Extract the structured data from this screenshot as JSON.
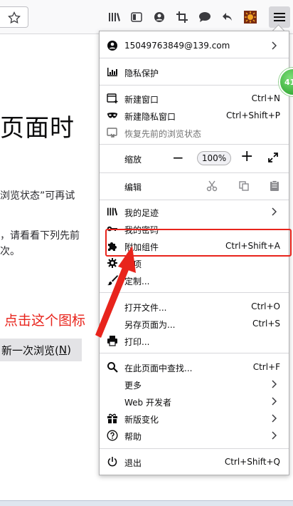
{
  "page": {
    "title_fragment": "页面时",
    "line1_fragment": "浏览状态”可再试",
    "line2_fragment": "，请看看下列先前",
    "line3_fragment": "次。",
    "restore_button_prefix": "新一次浏览(",
    "restore_button_key": "N",
    "restore_button_suffix": ")"
  },
  "annotation": {
    "text": "点击这个图标",
    "color": "#e8241c"
  },
  "badge": {
    "text": "41"
  },
  "menu": {
    "account": {
      "label": "15049763849@139.com"
    },
    "privacy": {
      "label": "隐私保护"
    },
    "new_window": {
      "label": "新建窗口",
      "shortcut": "Ctrl+N"
    },
    "new_private": {
      "label": "新建隐私窗口",
      "shortcut": "Ctrl+Shift+P"
    },
    "restore_session": {
      "label": "恢复先前的浏览状态"
    },
    "zoom": {
      "label": "缩放",
      "minus": "−",
      "value": "100%",
      "plus": "+"
    },
    "edit": {
      "label": "编辑"
    },
    "library": {
      "label": "我的足迹"
    },
    "logins": {
      "label": "我的密码"
    },
    "addons": {
      "label": "附加组件",
      "shortcut": "Ctrl+Shift+A"
    },
    "options": {
      "label": "选项"
    },
    "customize": {
      "label": "定制..."
    },
    "open_file": {
      "label": "打开文件...",
      "shortcut": "Ctrl+O"
    },
    "save_page": {
      "label": "另存页面为...",
      "shortcut": "Ctrl+S"
    },
    "print": {
      "label": "打印..."
    },
    "find": {
      "label": "在此页面中查找...",
      "shortcut": "Ctrl+F"
    },
    "more": {
      "label": "更多"
    },
    "web_dev": {
      "label": "Web 开发者"
    },
    "whats_new": {
      "label": "新版变化"
    },
    "help": {
      "label": "帮助"
    },
    "quit": {
      "label": "退出",
      "shortcut": "Ctrl+Shift+Q"
    }
  },
  "colors": {
    "accent_red": "#e8241c",
    "menu_border": "#b1b1b3",
    "toolbar_bg": "#f9f9fa"
  }
}
